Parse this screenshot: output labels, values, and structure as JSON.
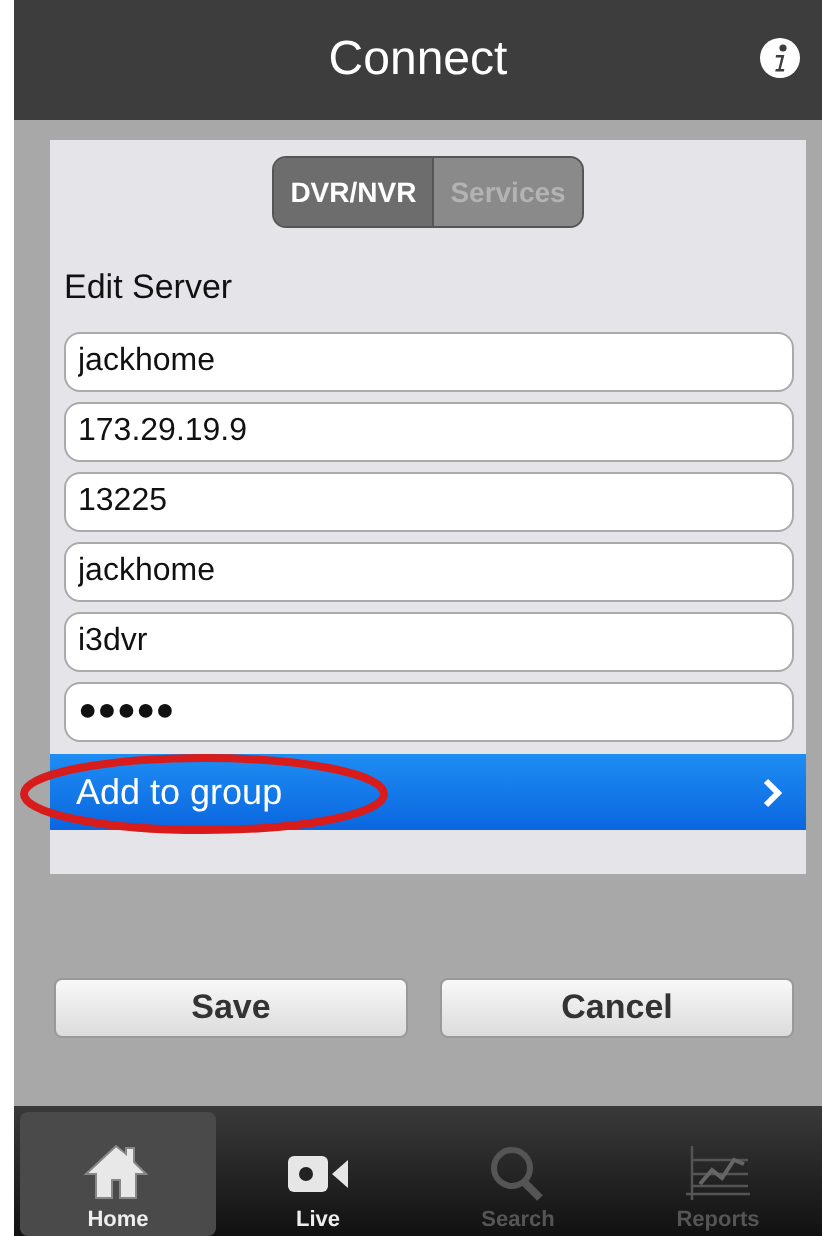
{
  "nav_bar": {
    "title": "Connect"
  },
  "segments": [
    {
      "label": "DVR/NVR",
      "selected": true
    },
    {
      "label": "Services",
      "selected": false
    }
  ],
  "section_title": "Edit Server",
  "fields": [
    {
      "value": "jackhome"
    },
    {
      "value": "173.29.19.9"
    },
    {
      "value": "13225"
    },
    {
      "value": "jackhome"
    },
    {
      "value": "i3dvr"
    },
    {
      "value": "●●●●●"
    }
  ],
  "group_row": {
    "label": "Add to group",
    "highlighted": true
  },
  "buttons": [
    "Save",
    "Cancel"
  ],
  "tabs": [
    {
      "label": "Home",
      "kind": "home",
      "selected": true,
      "disabled": false
    },
    {
      "label": "Live",
      "kind": "live",
      "selected": false,
      "disabled": false
    },
    {
      "label": "Search",
      "kind": "search",
      "selected": false,
      "disabled": true
    },
    {
      "label": "Reports",
      "kind": "reports",
      "selected": false,
      "disabled": true
    }
  ]
}
